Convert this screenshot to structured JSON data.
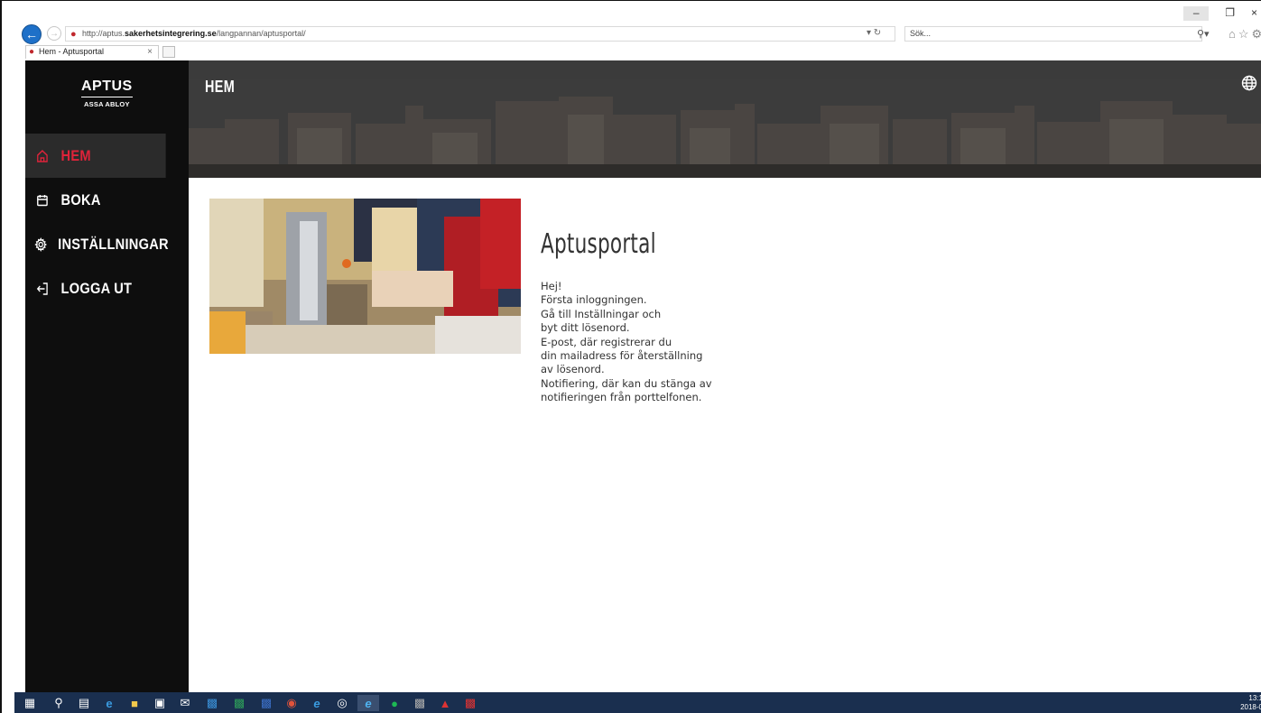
{
  "browser": {
    "url_prefix": "http://aptus.",
    "url_domain": "sakerhetsintegrering.se",
    "url_path": "/langpannan/aptusportal/",
    "search_placeholder": "Sök...",
    "tab_title": "Hem - Aptusportal"
  },
  "brand": {
    "name": "APTUS",
    "sub": "ASSA ABLOY",
    "accent_color": "#e0233a"
  },
  "sidebar": {
    "items": [
      {
        "label": "HEM",
        "icon": "home-icon",
        "active": true
      },
      {
        "label": "BOKA",
        "icon": "calendar-icon",
        "active": false
      },
      {
        "label": "INSTÄLLNINGAR",
        "icon": "gear-icon",
        "active": false
      },
      {
        "label": "LOGGA UT",
        "icon": "logout-icon",
        "active": false
      }
    ]
  },
  "header": {
    "title": "HEM"
  },
  "main": {
    "title": "Aptusportal",
    "lines": [
      "Hej!",
      "Första inloggningen.",
      "Gå till Inställningar och",
      "byt ditt lösenord.",
      "E-post, där registrerar du",
      "din mailadress för återställning",
      "av lösenord.",
      "Notifiering, där kan du stänga av",
      "notifieringen från porttelfonen."
    ]
  },
  "taskbar": {
    "time": "13:1",
    "date": "2018-0"
  }
}
